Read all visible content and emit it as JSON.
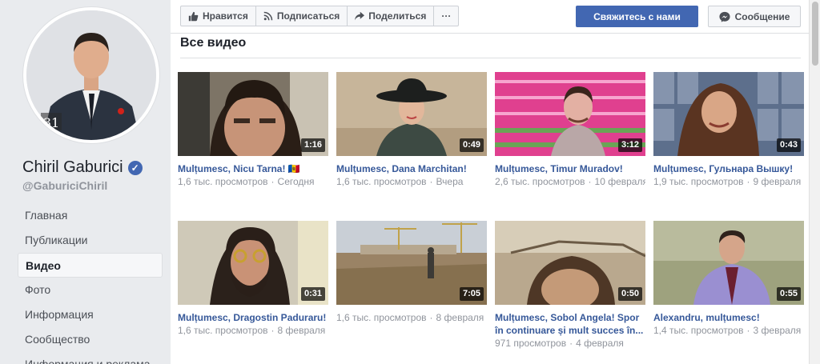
{
  "profile": {
    "name": "Chiril Gaburici",
    "handle": "@GaburiciChiril",
    "avatar_badge": "31",
    "verified_mark": "✓"
  },
  "nav": [
    {
      "label": "Главная",
      "active": false
    },
    {
      "label": "Публикации",
      "active": false
    },
    {
      "label": "Видео",
      "active": true
    },
    {
      "label": "Фото",
      "active": false
    },
    {
      "label": "Информация",
      "active": false
    },
    {
      "label": "Сообщество",
      "active": false
    },
    {
      "label": "Информация и реклама",
      "active": false
    }
  ],
  "actions": {
    "like": "Нравится",
    "follow": "Подписаться",
    "share": "Поделиться",
    "more": "···",
    "contact": "Свяжитесь с нами",
    "message": "Сообщение"
  },
  "section": {
    "title": "Все видео"
  },
  "videos": [
    {
      "title": "Mulțumesc, Nicu Tarna! 🇲🇩",
      "views": "1,6 тыс. просмотров",
      "date": "Сегодня",
      "duration": "1:16",
      "thumb": "t1"
    },
    {
      "title": "Mulțumesc, Dana Marchitan!",
      "views": "1,6 тыс. просмотров",
      "date": "Вчера",
      "duration": "0:49",
      "thumb": "t2"
    },
    {
      "title": "Mulțumesc, Timur Muradov!",
      "views": "2,6 тыс. просмотров",
      "date": "10 февраля",
      "duration": "3:12",
      "thumb": "t3"
    },
    {
      "title": "Mulțumesc, Гульнара Вышку!",
      "views": "1,9 тыс. просмотров",
      "date": "9 февраля",
      "duration": "0:43",
      "thumb": "t4"
    },
    {
      "title": "Mulțumesc, Dragostin Paduraru!",
      "views": "1,6 тыс. просмотров",
      "date": "8 февраля",
      "duration": "0:31",
      "thumb": "t5"
    },
    {
      "title": "",
      "views": "1,6 тыс. просмотров",
      "date": "8 февраля",
      "duration": "7:05",
      "thumb": "t6"
    },
    {
      "title": "Mulțumesc, Sobol Angela! Spor în continuare și mult succes în...",
      "views": "971 просмотров",
      "date": "4 февраля",
      "duration": "0:50",
      "thumb": "t7"
    },
    {
      "title": "Alexandru, mulțumesc!",
      "views": "1,4 тыс. просмотров",
      "date": "3 февраля",
      "duration": "0:55",
      "thumb": "t8"
    }
  ],
  "icons": {
    "like": "thumbs-up-icon",
    "follow": "rss-icon",
    "share": "share-arrow-icon",
    "message": "messenger-icon",
    "verified": "verified-badge-icon"
  },
  "colors": {
    "brand_blue": "#4267b2",
    "link_blue": "#365899",
    "meta_gray": "#90949c",
    "page_bg": "#e9ebee"
  }
}
